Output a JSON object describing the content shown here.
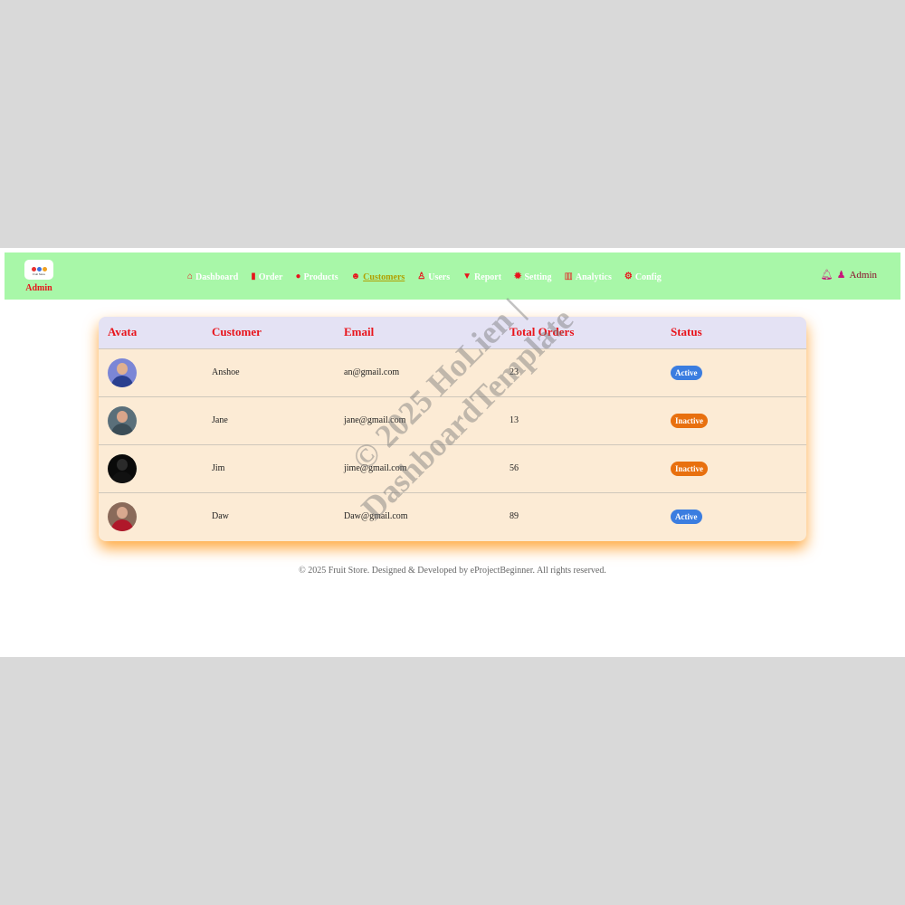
{
  "brand": {
    "logo_text": "Fruit Store",
    "label": "Admin"
  },
  "nav": [
    {
      "icon": "home-icon",
      "glyph": "⌂",
      "label": "Dashboard",
      "active": false
    },
    {
      "icon": "book-icon",
      "glyph": "▮",
      "label": "Order",
      "active": false
    },
    {
      "icon": "product-icon",
      "glyph": "●",
      "label": "Products",
      "active": false
    },
    {
      "icon": "customers-icon",
      "glyph": "☻",
      "label": "Customers",
      "active": true
    },
    {
      "icon": "user-icon",
      "glyph": "♙",
      "label": "Users",
      "active": false
    },
    {
      "icon": "filter-icon",
      "glyph": "▼",
      "label": "Report",
      "active": false
    },
    {
      "icon": "gear-icon",
      "glyph": "✹",
      "label": "Setting",
      "active": false
    },
    {
      "icon": "bar-chart-icon",
      "glyph": "▥",
      "label": "Analytics",
      "active": false
    },
    {
      "icon": "cogs-icon",
      "glyph": "⚙",
      "label": "Config",
      "active": false
    }
  ],
  "user": {
    "name": "Admin"
  },
  "table": {
    "headers": [
      "Avata",
      "Customer",
      "Email",
      "Total Orders",
      "Status"
    ],
    "rows": [
      {
        "name": "Anshoe",
        "email": "an@gmail.com",
        "orders": "23",
        "status": "Active"
      },
      {
        "name": "Jane",
        "email": "jane@gmail.com",
        "orders": "13",
        "status": "Inactive"
      },
      {
        "name": "Jim",
        "email": "jime@gmail.com",
        "orders": "56",
        "status": "Inactive"
      },
      {
        "name": "Daw",
        "email": "Daw@gmail.com",
        "orders": "89",
        "status": "Active"
      }
    ]
  },
  "colors": {
    "active": "#3b7de0",
    "inactive": "#e8700f"
  },
  "footer": "© 2025 Fruit Store. Designed & Developed by eProjectBeginner. All rights reserved.",
  "watermark": {
    "line1": "© 2025 HoLien |",
    "line2": "DashboardTemplate"
  }
}
